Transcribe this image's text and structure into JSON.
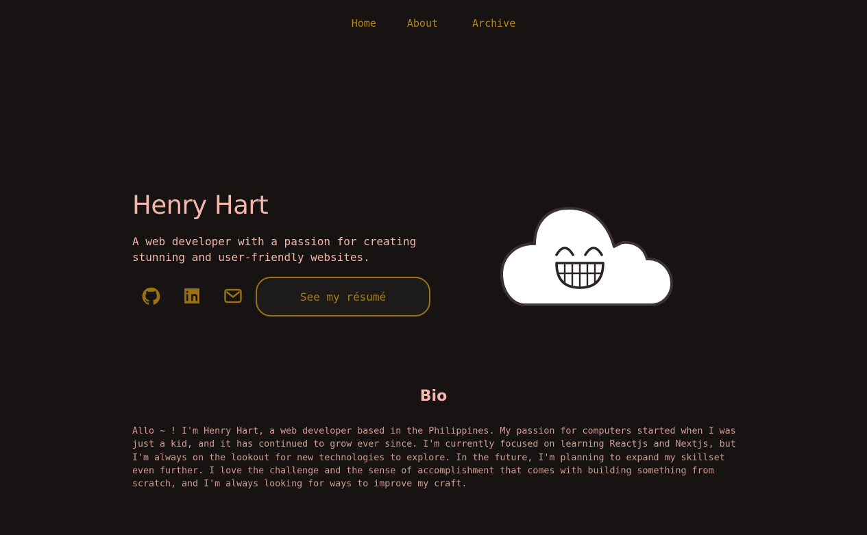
{
  "nav": {
    "home": "Home",
    "about": "About",
    "archive": "Archive"
  },
  "hero": {
    "name": "Henry Hart",
    "tagline": "A web developer with a passion for creating stunning and user-friendly websites.",
    "resume_button": "See my résumé",
    "social_icons": [
      "github-icon",
      "linkedin-icon",
      "mail-icon"
    ],
    "illustration": "smiling-cloud"
  },
  "bio": {
    "title": "Bio",
    "text": "Allo ~ ! I'm Henry Hart, a web developer based in the Philippines. My passion for computers started when I was just a kid, and it has continued to grow ever since. I'm currently focused on learning Reactjs and Nextjs, but I'm always on the lookout for new technologies to explore. In the future, I'm planning to expand my skillset even further. I love the challenge and the sense of accomplishment that comes with building something from scratch, and I'm always looking for ways to improve my craft."
  },
  "colors": {
    "background": "#161312",
    "accent_gold": "#b8860b",
    "heading_pink": "#f4b6aa",
    "text_pink": "#d49a92"
  }
}
